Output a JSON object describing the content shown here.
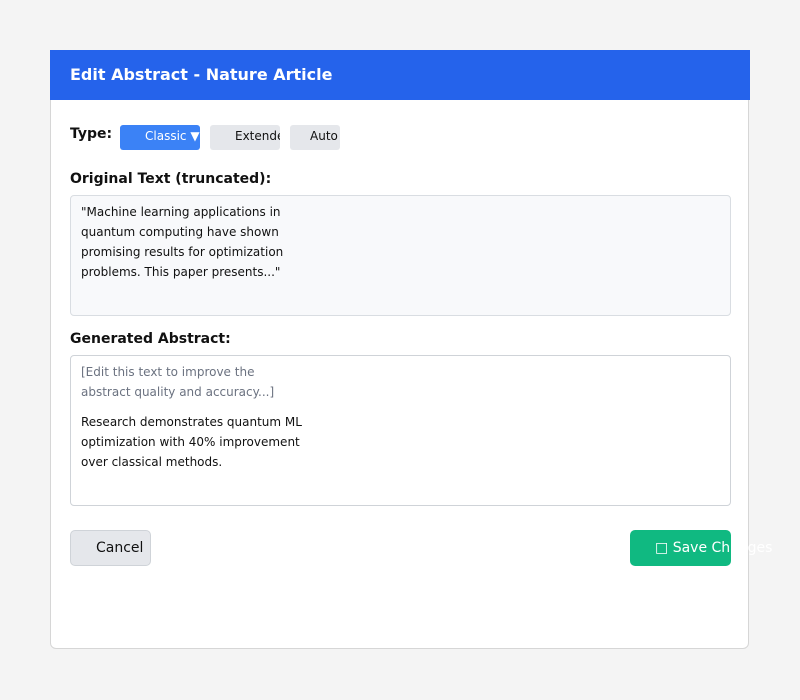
{
  "dialog": {
    "title": "Edit Abstract - Nature Article"
  },
  "type_selector": {
    "label": "Type:",
    "options": [
      {
        "label": "Classic ▼",
        "selected": true
      },
      {
        "label": "Extended",
        "selected": false
      },
      {
        "label": "Auto",
        "selected": false
      }
    ]
  },
  "original": {
    "label": "Original Text (truncated):",
    "lines": [
      "\"Machine learning applications in",
      "quantum computing have shown",
      "promising results for optimization",
      "problems. This paper presents...\""
    ]
  },
  "generated": {
    "label": "Generated Abstract:",
    "placeholder_lines": [
      "[Edit this text to improve the",
      "abstract quality and accuracy...]"
    ],
    "content_lines": [
      "Research demonstrates quantum ML",
      "optimization with 40% improvement",
      "over classical methods."
    ]
  },
  "actions": {
    "cancel_label": "Cancel",
    "save_icon": "□",
    "save_label": "Save Changes"
  },
  "colors": {
    "header": "#2563eb",
    "selected_type": "#3b82f6",
    "save": "#10b981",
    "neutral_button": "#e5e7eb"
  }
}
